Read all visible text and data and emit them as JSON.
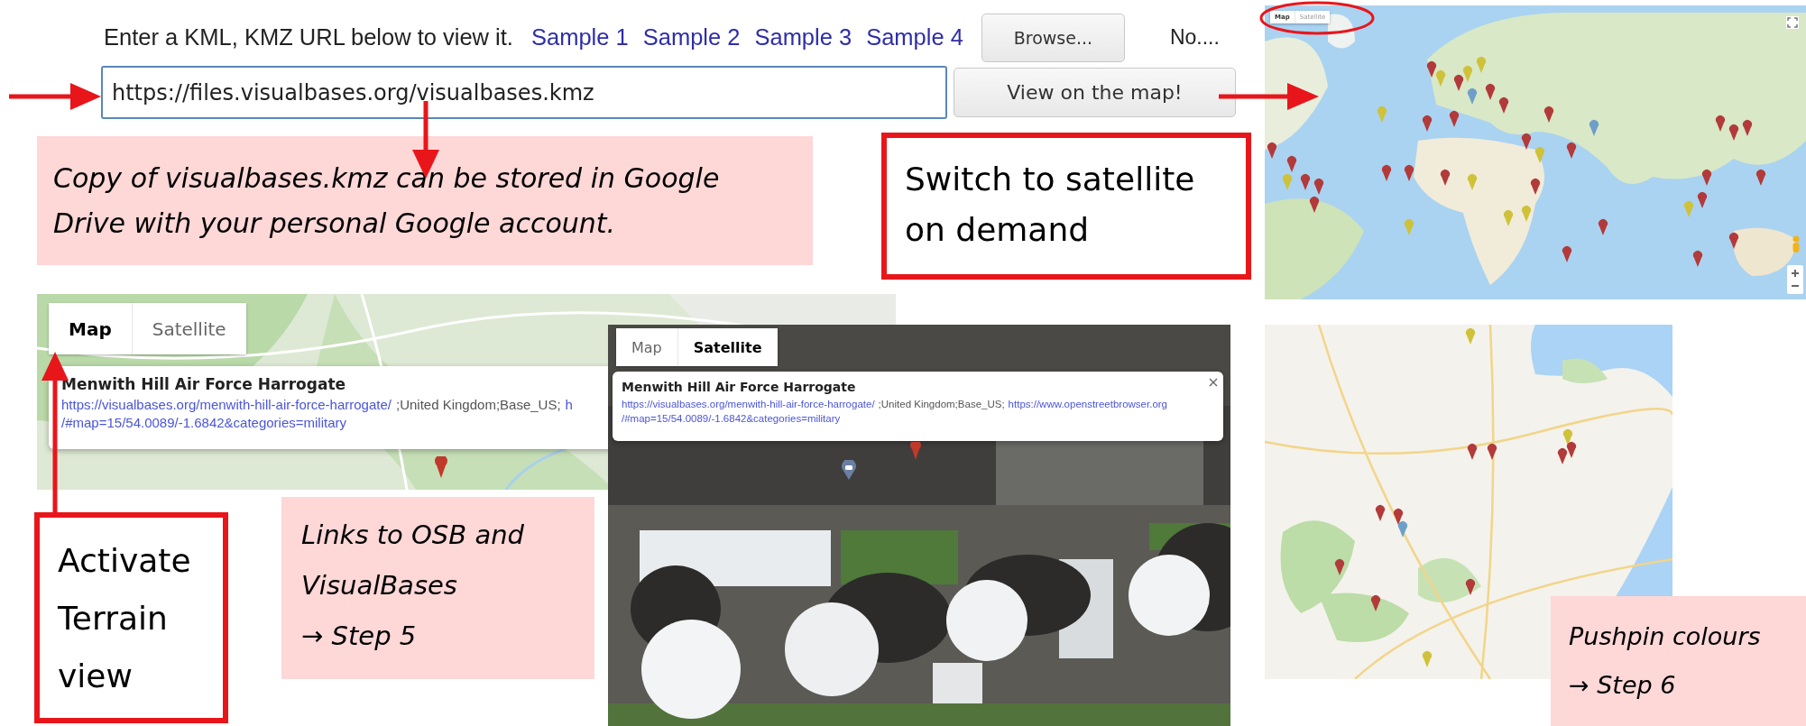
{
  "loader": {
    "prompt": "Enter a KML, KMZ URL below to view it.",
    "samples": [
      "Sample 1",
      "Sample 2",
      "Sample 3",
      "Sample 4"
    ],
    "browse_button": "Browse...",
    "file_status": "No....",
    "url_field": {
      "value": "https://files.visualbases.org/visualbases.kmz"
    },
    "view_button": "View on the map!"
  },
  "callouts": [
    {
      "kind": "note",
      "lines": [
        "Copy of visualbases.kmz can be stored in Google Drive with your personal Google account."
      ]
    },
    {
      "kind": "boxed",
      "lines": [
        "Switch to satellite on demand"
      ]
    },
    {
      "kind": "boxed",
      "lines": [
        "Activate Terrain view"
      ]
    },
    {
      "kind": "note",
      "lines": [
        "Links to OSB and VisualBases",
        "→ Step 5"
      ]
    },
    {
      "kind": "note",
      "lines": [
        "Pushpin colours",
        "→ Step 6"
      ]
    }
  ],
  "world_map": {
    "map_types": [
      {
        "label": "Map",
        "selected": true
      },
      {
        "label": "Satellite",
        "selected": false
      }
    ]
  },
  "terrain_map": {
    "map_types": [
      {
        "label": "Map",
        "selected": true
      },
      {
        "label": "Satellite",
        "selected": false
      }
    ],
    "popup": {
      "title": "Menwith Hill Air Force Harrogate",
      "lines": [
        [
          {
            "kind": "link",
            "text": "https://visualbases.org/menwith-hill-air-force-harrogate/"
          },
          {
            "kind": "text",
            "text": ";United Kingdom;Base_US;"
          },
          {
            "kind": "link",
            "text": "h"
          }
        ],
        [
          {
            "kind": "link",
            "text": "/#map=15/54.0089/-1.6842&categories=military"
          }
        ]
      ]
    }
  },
  "satellite_map": {
    "map_types": [
      {
        "label": "Map",
        "selected": false
      },
      {
        "label": "Satellite",
        "selected": true
      }
    ],
    "popup": {
      "title": "Menwith Hill Air Force Harrogate",
      "lines": [
        [
          {
            "kind": "link",
            "text": "https://visualbases.org/menwith-hill-air-force-harrogate/"
          },
          {
            "kind": "text",
            "text": ";United Kingdom;Base_US;"
          },
          {
            "kind": "link",
            "text": "https://www.openstreetbrowser.org"
          }
        ],
        [
          {
            "kind": "link",
            "text": "/#map=15/54.0089/-1.6842&categories=military"
          }
        ]
      ]
    }
  }
}
